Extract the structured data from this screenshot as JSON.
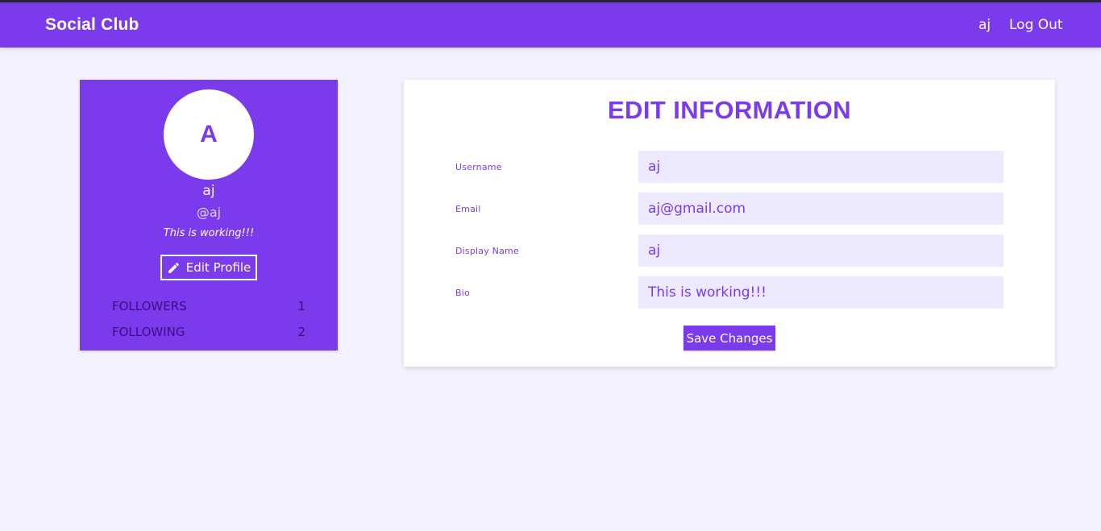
{
  "navbar": {
    "brand": "Social Club",
    "user_link": "aj",
    "logout_label": "Log Out",
    "color": "#7c3aed"
  },
  "profile": {
    "avatar_letter": "A",
    "name": "aj",
    "handle": "@aj",
    "bio": "This is working!!!",
    "edit_button_label": "Edit Profile",
    "edit_icon": "pencil-icon",
    "stats": [
      {
        "label": "FOLLOWERS",
        "value": "1"
      },
      {
        "label": "FOLLOWING",
        "value": "2"
      }
    ]
  },
  "edit_form": {
    "title": "EDIT INFORMATION",
    "fields": {
      "username": {
        "label": "Username",
        "value": "aj"
      },
      "email": {
        "label": "Email",
        "value": "aj@gmail.com"
      },
      "display_name": {
        "label": "Display Name",
        "value": "aj"
      },
      "bio": {
        "label": "Bio",
        "value": "This is working!!!"
      }
    },
    "save_label": "Save Changes"
  },
  "colors": {
    "accent": "#7c3aed",
    "page_background": "#f3f1fe",
    "input_background": "#ede9fe"
  }
}
